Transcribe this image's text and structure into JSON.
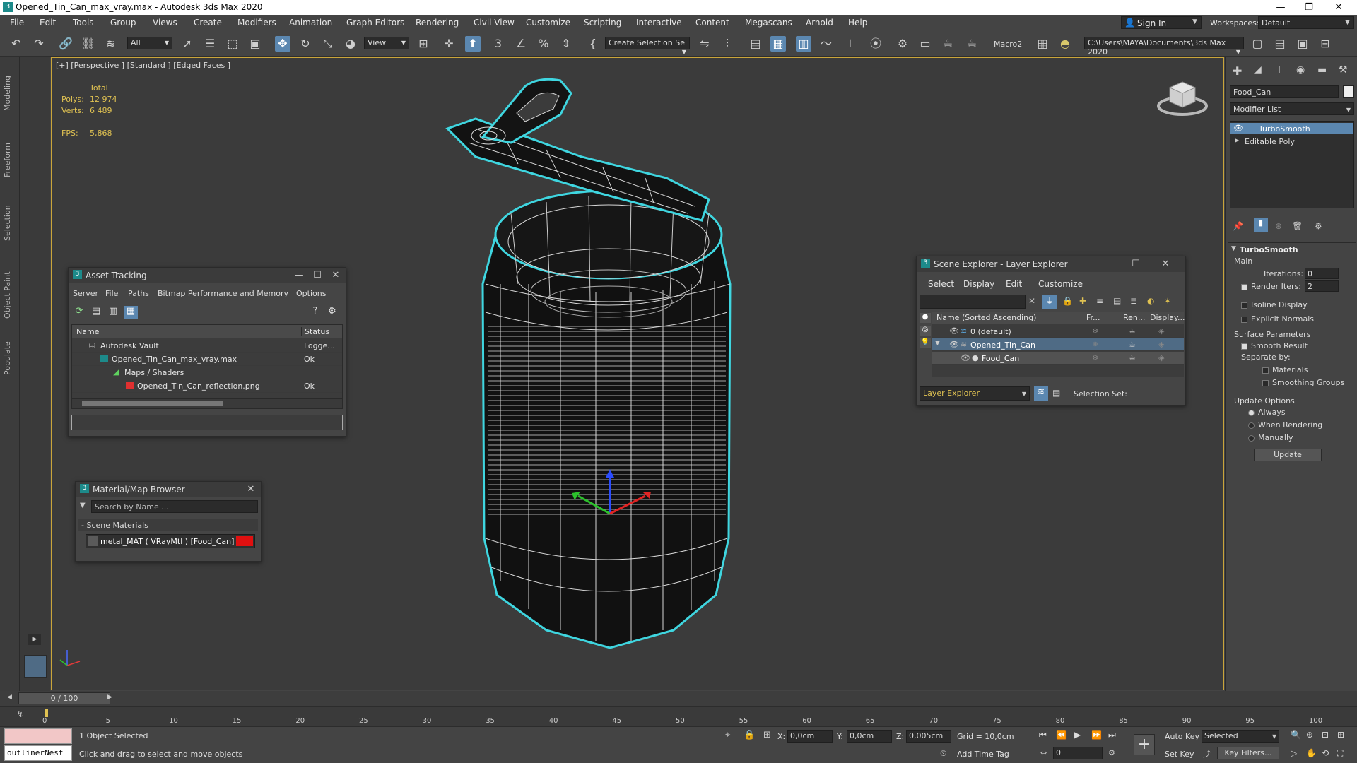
{
  "window": {
    "title": "Opened_Tin_Can_max_vray.max - Autodesk 3ds Max 2020",
    "minimize": "—",
    "restore": "❐",
    "close": "✕"
  },
  "menu": [
    "File",
    "Edit",
    "Tools",
    "Group",
    "Views",
    "Create",
    "Modifiers",
    "Animation",
    "Graph Editors",
    "Rendering",
    "Civil View",
    "Customize",
    "Scripting",
    "Interactive",
    "Content",
    "Megascans",
    "Arnold",
    "Help"
  ],
  "account": {
    "sign_in": "Sign In",
    "workspaces_label": "Workspaces:",
    "workspace_value": "Default"
  },
  "toolbar": {
    "selection_filter": "All",
    "view_dropdown": "View",
    "create_selection_set": "Create Selection Se",
    "macro": "Macro2",
    "path": "C:\\Users\\MAYA\\Documents\\3ds Max 2020"
  },
  "left_tabs": [
    "Modeling",
    "Freeform",
    "Selection",
    "Object Paint",
    "Populate"
  ],
  "viewport": {
    "label": "[+] [Perspective ] [Standard ] [Edged Faces ]",
    "stats": {
      "total_label": "Total",
      "polys_label": "Polys:",
      "polys_value": "12 974",
      "verts_label": "Verts:",
      "verts_value": "6 489",
      "fps_label": "FPS:",
      "fps_value": "5,868"
    }
  },
  "command_panel": {
    "object_name": "Food_Can",
    "modifier_list": "Modifier List",
    "stack": [
      "TurboSmooth",
      "Editable Poly"
    ],
    "rollout_title": "TurboSmooth",
    "main": "Main",
    "iterations_label": "Iterations:",
    "iterations_value": "0",
    "render_iters_label": "Render Iters:",
    "render_iters_value": "2",
    "isoline_display": "Isoline Display",
    "explicit_normals": "Explicit Normals",
    "surface_parameters": "Surface Parameters",
    "smooth_result": "Smooth Result",
    "separate_by": "Separate by:",
    "materials": "Materials",
    "smoothing_groups": "Smoothing Groups",
    "update_options": "Update Options",
    "always": "Always",
    "when_rendering": "When Rendering",
    "manually": "Manually",
    "update_button": "Update"
  },
  "asset_tracking": {
    "title": "Asset Tracking",
    "menu": [
      "Server",
      "File",
      "Paths",
      "Bitmap Performance and Memory",
      "Options"
    ],
    "columns": [
      "Name",
      "Status"
    ],
    "rows": [
      {
        "name": "Autodesk Vault",
        "status": "Logge..."
      },
      {
        "name": "Opened_Tin_Can_max_vray.max",
        "status": "Ok"
      },
      {
        "name": "Maps / Shaders",
        "status": ""
      },
      {
        "name": "Opened_Tin_Can_reflection.png",
        "status": "Ok"
      }
    ]
  },
  "material_browser": {
    "title": "Material/Map Browser",
    "search_placeholder": "Search by Name ...",
    "group": "- Scene Materials",
    "item": "metal_MAT  ( VRayMtl )  [Food_Can]"
  },
  "scene_explorer": {
    "title": "Scene Explorer - Layer Explorer",
    "menu": [
      "Select",
      "Display",
      "Edit",
      "Customize"
    ],
    "columns": [
      "Name (Sorted Ascending)",
      "Fr...",
      "Ren...",
      "Display..."
    ],
    "rows": [
      "0 (default)",
      "Opened_Tin_Can",
      "Food_Can"
    ],
    "footer_dropdown": "Layer Explorer",
    "selection_set": "Selection Set:"
  },
  "timeline": {
    "frame_display": "0 / 100",
    "ticks": [
      "0",
      "5",
      "10",
      "15",
      "20",
      "25",
      "30",
      "35",
      "40",
      "45",
      "50",
      "55",
      "60",
      "65",
      "70",
      "75",
      "80",
      "85",
      "90",
      "95",
      "100"
    ]
  },
  "status": {
    "script_listener": "outlinerNest",
    "selection": "1 Object Selected",
    "prompt": "Click and drag to select and move objects",
    "x_label": "X:",
    "x_value": "0,0cm",
    "y_label": "Y:",
    "y_value": "0,0cm",
    "z_label": "Z:",
    "z_value": "0,005cm",
    "grid": "Grid = 10,0cm",
    "add_time_tag": "Add Time Tag",
    "auto_key": "Auto Key",
    "set_key": "Set Key",
    "selected_dropdown": "Selected",
    "key_filters": "Key Filters...",
    "frame_value": "0"
  },
  "colors": {
    "wire_highlight": "#3fd6e0",
    "wire": "#d8d8d8",
    "stats": "#e0c252",
    "selection": "#5b87b0"
  }
}
